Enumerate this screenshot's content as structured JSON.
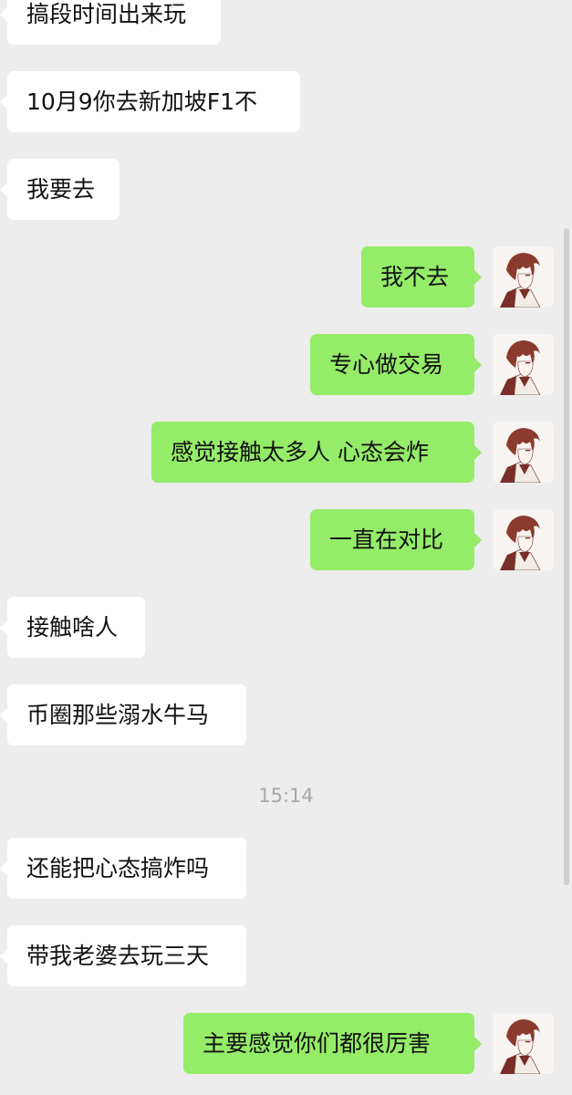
{
  "messages": [
    {
      "text": "搞段时间出来玩"
    },
    {
      "text": "10月9你去新加坡F1不"
    },
    {
      "text": "我要去"
    },
    {
      "text": "我不去"
    },
    {
      "text": "专心做交易"
    },
    {
      "text": "感觉接触太多人 心态会炸"
    },
    {
      "text": "一直在对比"
    },
    {
      "text": "接触啥人"
    },
    {
      "text": "币圈那些溺水牛马"
    },
    {
      "text": "还能把心态搞炸吗"
    },
    {
      "text": "带我老婆去玩三天"
    },
    {
      "text": "主要感觉你们都很厉害"
    }
  ],
  "timestamp": "15:14",
  "colors": {
    "background": "#ededed",
    "incoming_bubble": "#ffffff",
    "outgoing_bubble": "#95ec69",
    "timestamp_text": "#a8a8a8"
  },
  "avatar_icon": "anime-boy-avatar-icon"
}
